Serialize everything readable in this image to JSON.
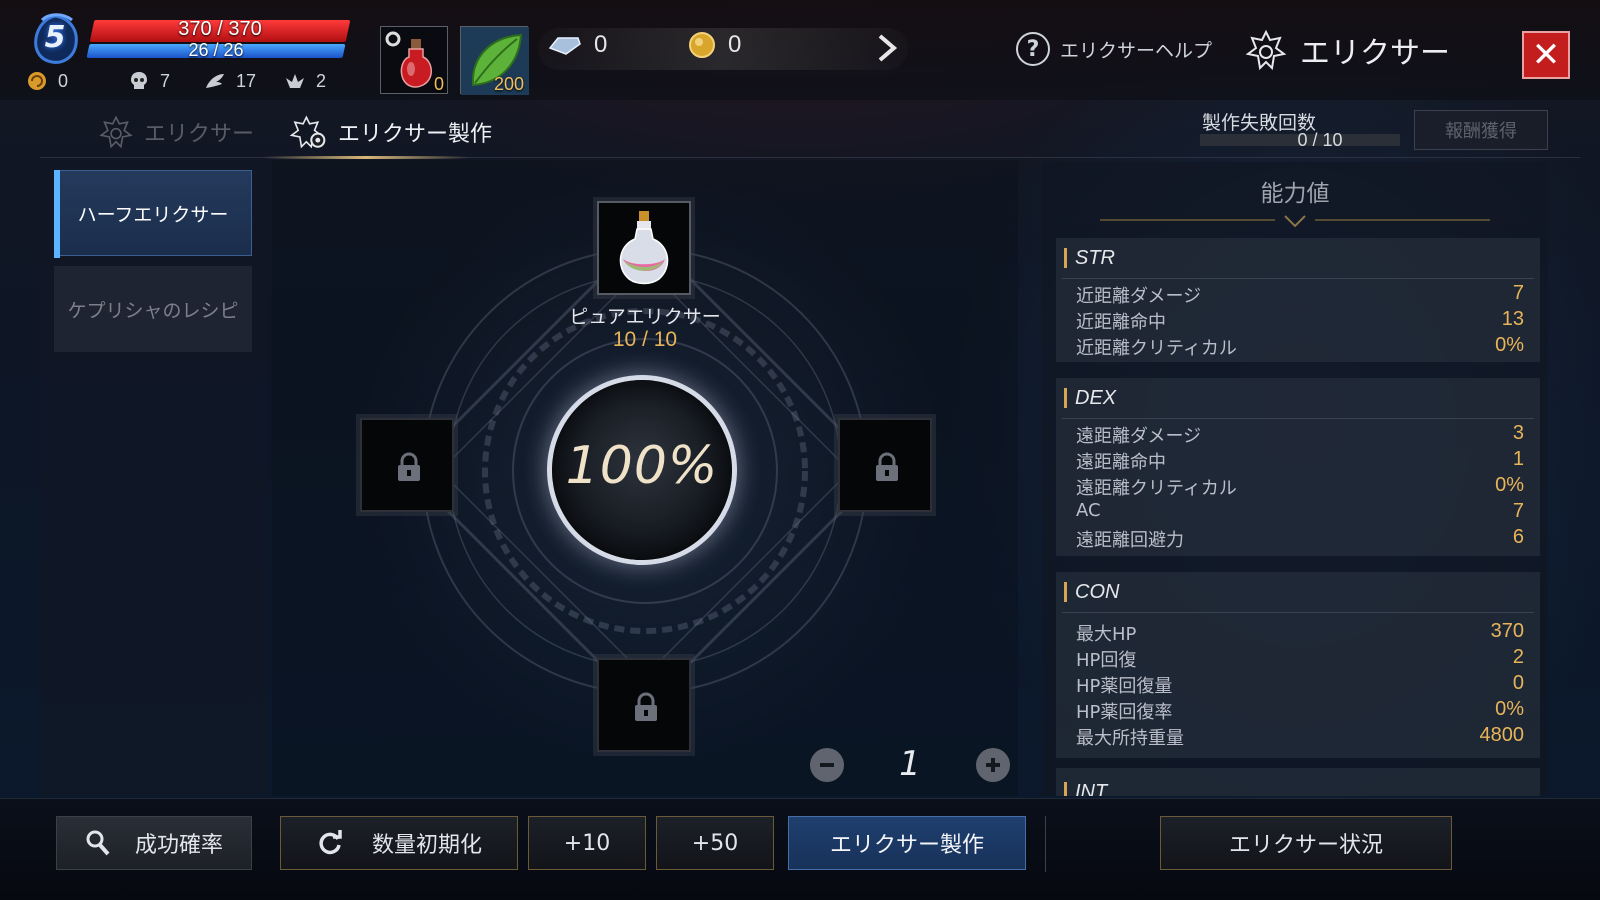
{
  "player": {
    "level": "5",
    "hp": "370 / 370",
    "mp": "26 / 26",
    "stats": [
      {
        "icon": "coin-swirl-icon",
        "value": "0"
      },
      {
        "icon": "skull-icon",
        "value": "7"
      },
      {
        "icon": "wing-icon",
        "value": "17"
      },
      {
        "icon": "winged-crest-icon",
        "value": "2"
      }
    ]
  },
  "items": [
    {
      "icon": "red-potion-icon",
      "count": "0"
    },
    {
      "icon": "green-leaf-icon",
      "count": "200"
    }
  ],
  "currencies": [
    {
      "icon": "diamond-icon",
      "value": "0"
    },
    {
      "icon": "gold-coin-icon",
      "value": "0"
    }
  ],
  "header": {
    "help_label": "エリクサーヘルプ",
    "title": "エリクサー"
  },
  "tabs": [
    {
      "label": "エリクサー",
      "active": false
    },
    {
      "label": "エリクサー製作",
      "active": true
    }
  ],
  "fail": {
    "label": "製作失敗回数",
    "value": "0 / 10",
    "progress": 0
  },
  "reward_label": "報酬獲得",
  "recipes": [
    {
      "label": "ハーフエリクサー",
      "selected": true
    },
    {
      "label": "ケプリシャのレシピ",
      "selected": false
    }
  ],
  "crafting": {
    "ingredient_name": "ピュアエリクサー",
    "ingredient_count": "10 / 10",
    "success_rate": "100%",
    "quantity": "1"
  },
  "stats_panel": {
    "title": "能力値",
    "groups": [
      {
        "name": "STR",
        "rows": [
          {
            "label": "近距離ダメージ",
            "value": "7"
          },
          {
            "label": "近距離命中",
            "value": "13"
          },
          {
            "label": "近距離クリティカル",
            "value": "0%"
          }
        ]
      },
      {
        "name": "DEX",
        "rows": [
          {
            "label": "遠距離ダメージ",
            "value": "3"
          },
          {
            "label": "遠距離命中",
            "value": "1"
          },
          {
            "label": "遠距離クリティカル",
            "value": "0%"
          },
          {
            "label": "AC",
            "value": "7"
          },
          {
            "label": "遠距離回避力",
            "value": "6"
          }
        ]
      },
      {
        "name": "CON",
        "rows": [
          {
            "label": "最大HP",
            "value": "370"
          },
          {
            "label": "HP回復",
            "value": "2"
          },
          {
            "label": "HP薬回復量",
            "value": "0"
          },
          {
            "label": "HP薬回復率",
            "value": "0%"
          },
          {
            "label": "最大所持重量",
            "value": "4800"
          }
        ]
      },
      {
        "name": "INT",
        "rows": []
      }
    ]
  },
  "bottom": {
    "success_rate_label": "成功確率",
    "reset_label": "数量初期化",
    "plus10_label": "+10",
    "plus50_label": "+50",
    "craft_label": "エリクサー製作",
    "status_label": "エリクサー状況"
  },
  "colors": {
    "accent_gold": "#e8b45a",
    "hp_red": "#ff3a3a",
    "mp_blue": "#4ba8ff",
    "primary_button": "#1f3f6e",
    "close_red": "#c41d1d"
  }
}
